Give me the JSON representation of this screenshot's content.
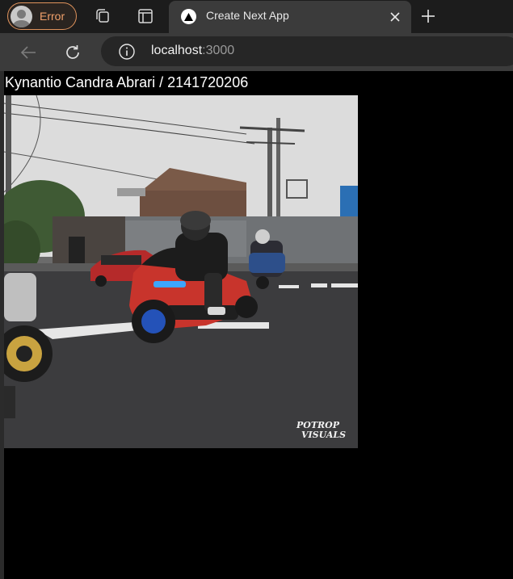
{
  "browser": {
    "profile": {
      "label": "Error",
      "icon": "avatar-icon",
      "accent": "#e0935c"
    },
    "toolbar_icons": [
      "collections-icon",
      "tab-actions-icon"
    ],
    "tab": {
      "title": "Create Next App",
      "favicon": "nextjs-triangle-icon"
    },
    "new_tab_icon": "plus-icon",
    "address": {
      "host": "localhost",
      "port": ":3000",
      "icon": "info-icon"
    },
    "nav": {
      "back_icon": "back-arrow-icon",
      "refresh_icon": "refresh-icon"
    }
  },
  "page": {
    "heading": "Kynantio Candra Abrari / 2141720206",
    "image": {
      "watermark_line1": "POTROP",
      "watermark_line2": "VISUALS"
    }
  },
  "colors": {
    "page_bg": "#000000",
    "tab_active": "#3b3b3b",
    "tabbar_bg": "#1c1c1c",
    "error_accent": "#f0a06a"
  }
}
